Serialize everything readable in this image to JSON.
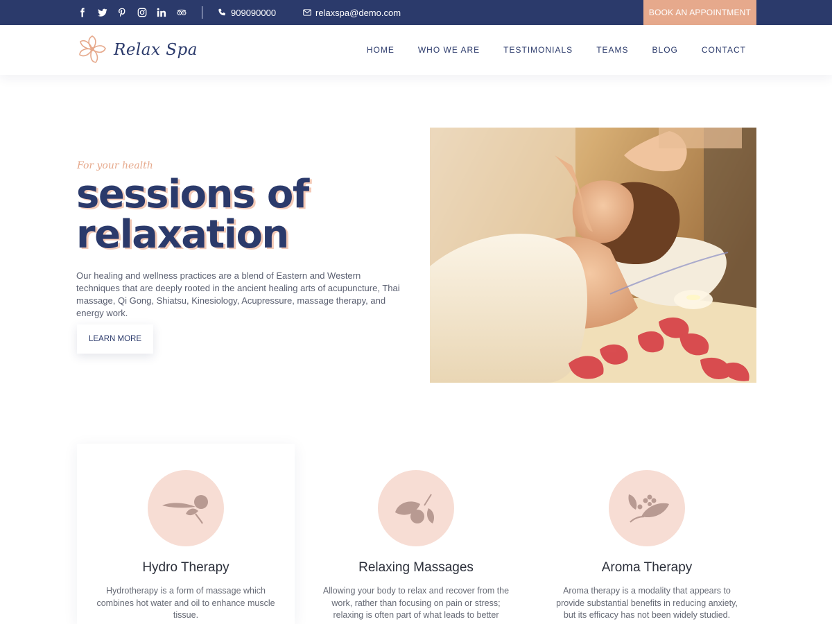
{
  "topbar": {
    "social_icons": [
      "facebook-icon",
      "twitter-icon",
      "pinterest-icon",
      "instagram-icon",
      "linkedin-icon",
      "tripadvisor-icon"
    ],
    "phone": "909090000",
    "email": "relaxspa@demo.com",
    "book_label": "BOOK AN APPOINTMENT"
  },
  "header": {
    "logo_text": "Relax Spa",
    "nav": [
      "HOME",
      "WHO WE ARE",
      "TESTIMONIALS",
      "TEAMS",
      "BLOG",
      "CONTACT"
    ]
  },
  "hero": {
    "tagline": "For your health",
    "title_line1": "sessions of",
    "title_line2": "relaxation",
    "description": "Our healing and wellness practices are a blend of Eastern and Western techniques that are deeply rooted in the ancient healing arts of acupuncture, Thai massage, Qi Gong, Shiatsu, Kinesiology, Acupressure, massage therapy, and energy work.",
    "button_label": "LEARN MORE"
  },
  "services": [
    {
      "icon": "hot-stone-icon",
      "title": "Hydro Therapy",
      "text": "Hydrotherapy is a form of massage which combines hot water and oil to enhance muscle tissue."
    },
    {
      "icon": "leaf-stone-icon",
      "title": "Relaxing Massages",
      "text": "Allowing your body to relax and recover from the work, rather than focusing on pain or stress; relaxing is often part of what leads to better"
    },
    {
      "icon": "flower-leaf-icon",
      "title": "Aroma Therapy",
      "text": "Aroma therapy is a modality that appears to provide substantial benefits in reducing anxiety, but its efficacy has not been widely studied."
    }
  ],
  "colors": {
    "navy": "#2b3a6b",
    "peach": "#e6a98c",
    "circle_bg": "#f7ddd4",
    "icon": "#b89a92"
  }
}
